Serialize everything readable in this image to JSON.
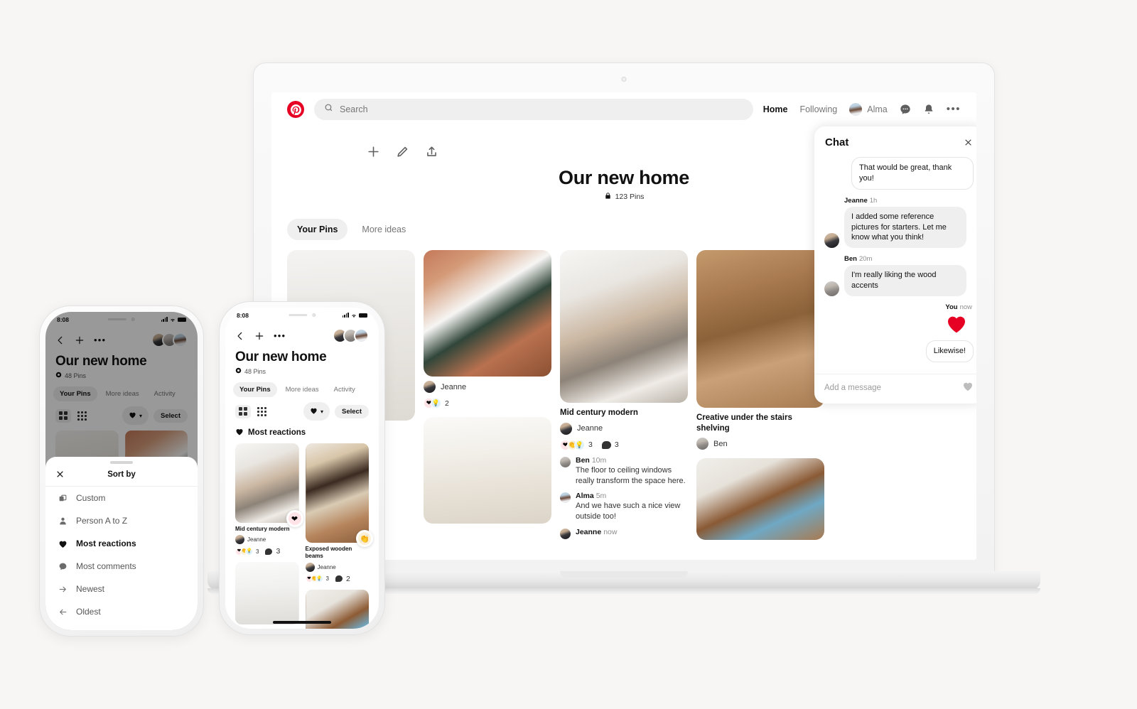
{
  "desktop": {
    "search": {
      "placeholder": "Search",
      "icon": "search-icon"
    },
    "nav": {
      "home": "Home",
      "following": "Following",
      "user": "Alma"
    },
    "board": {
      "title": "Our new home",
      "pin_count": "123 Pins",
      "invite_label": "Invite",
      "organize_label": "Organize",
      "tabs": [
        {
          "label": "Your Pins",
          "active": true
        },
        {
          "label": "More ideas",
          "active": false
        }
      ]
    },
    "pins": [
      {
        "id": "pin-white-room",
        "title": "",
        "author": "",
        "reactions": "",
        "comments": ""
      },
      {
        "id": "pin-eames-chair",
        "title": "",
        "author": "Jeanne",
        "reactions": "2",
        "comments": ""
      },
      {
        "id": "pin-mid-century",
        "title": "Mid century modern",
        "author": "Jeanne",
        "reactions": "3",
        "comments": "3",
        "thread": [
          {
            "name": "Ben",
            "time": "10m",
            "text": "The floor to ceiling windows really transform the space here."
          },
          {
            "name": "Alma",
            "time": "5m",
            "text": "And we have such a nice view outside too!"
          },
          {
            "name": "Jeanne",
            "time": "now",
            "text": ""
          }
        ]
      },
      {
        "id": "pin-stairs-shelving",
        "title": "Creative under the stairs shelving",
        "author": "Ben",
        "reactions": "",
        "comments": ""
      },
      {
        "id": "pin-bright-room",
        "title": "",
        "author": "",
        "reactions": "",
        "comments": ""
      },
      {
        "id": "pin-window-wood",
        "title": "",
        "author": "",
        "reactions": "",
        "comments": ""
      }
    ],
    "chat": {
      "title": "Chat",
      "input_placeholder": "Add a message",
      "messages": [
        {
          "side": "out",
          "name": "",
          "time": "",
          "text": "That would be great, thank you!"
        },
        {
          "side": "in",
          "name": "Jeanne",
          "time": "1h",
          "text": "I added some reference pictures for starters. Let me know what you think!"
        },
        {
          "side": "in",
          "name": "Ben",
          "time": "20m",
          "text": "I'm really liking the wood accents"
        },
        {
          "side": "out",
          "name": "You",
          "time": "now",
          "text": ""
        },
        {
          "side": "out",
          "name": "",
          "time": "",
          "text": "Likewise!"
        }
      ]
    }
  },
  "phone_left": {
    "status": {
      "time": "8:08"
    },
    "board": {
      "title": "Our new home",
      "pin_count": "48 Pins",
      "select_label": "Select",
      "tabs": [
        {
          "label": "Your Pins",
          "active": true
        },
        {
          "label": "More ideas",
          "active": false
        },
        {
          "label": "Activity",
          "active": false
        }
      ]
    },
    "sheet": {
      "title": "Sort by",
      "options": [
        {
          "label": "Custom",
          "icon": "custom-order-icon",
          "selected": false
        },
        {
          "label": "Person A to Z",
          "icon": "person-icon",
          "selected": false
        },
        {
          "label": "Most reactions",
          "icon": "heart-icon",
          "selected": true
        },
        {
          "label": "Most comments",
          "icon": "comment-icon",
          "selected": false
        },
        {
          "label": "Newest",
          "icon": "arrow-right-icon",
          "selected": false
        },
        {
          "label": "Oldest",
          "icon": "arrow-left-icon",
          "selected": false
        }
      ]
    }
  },
  "phone_right": {
    "status": {
      "time": "8:08"
    },
    "board": {
      "title": "Our new home",
      "pin_count": "48 Pins",
      "select_label": "Select",
      "section_header": "Most reactions",
      "tabs": [
        {
          "label": "Your Pins",
          "active": true
        },
        {
          "label": "More ideas",
          "active": false
        },
        {
          "label": "Activity",
          "active": false
        }
      ]
    },
    "pins": [
      {
        "title": "Mid century modern",
        "author": "Jeanne",
        "reactions": "3",
        "comments": "3"
      },
      {
        "title": "Exposed wooden beams",
        "author": "Jeanne",
        "reactions": "3",
        "comments": "2"
      }
    ]
  },
  "colors": {
    "brand_red": "#e60023",
    "page_bg": "#f7f6f5",
    "chip_bg": "#efefef",
    "text_primary": "#111111",
    "text_secondary": "#767676"
  }
}
